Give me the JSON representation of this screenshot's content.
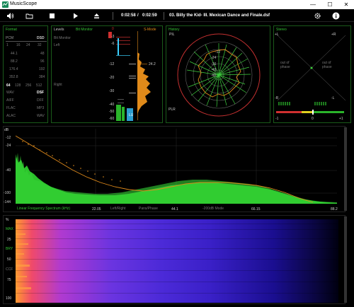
{
  "app": {
    "title": "MusicScope"
  },
  "toolbar": {
    "position": "0:02:58",
    "separator": "/",
    "duration": "0:02:59",
    "track": "03. Billy the Kid- III. Mexican Dance and Finale.dsf"
  },
  "format": {
    "title": "Format",
    "pcm": "PCM",
    "dsd": "DSD",
    "pcm_rates": [
      "1",
      "16",
      "24",
      "32"
    ],
    "rows": [
      [
        "44.1",
        "48"
      ],
      [
        "88.2",
        "96"
      ],
      [
        "176.4",
        "192"
      ],
      [
        "352.8",
        "384"
      ]
    ],
    "dsd_rates": [
      "64",
      "128",
      "256",
      "512"
    ],
    "pairs": [
      [
        "WAV",
        "DSF"
      ],
      [
        "AIFF",
        "DFF"
      ],
      [
        "FLAC",
        "MP3"
      ],
      [
        "ALAC",
        "WAV"
      ]
    ]
  },
  "levels": {
    "title": "Levels",
    "mode": "Bit Monitor",
    "left": "Left",
    "right": "Right",
    "bitmonitor": "Bit Monitor"
  },
  "meter": {
    "smode": "S-Mode",
    "ticks": [
      "0",
      "-3",
      "-6",
      "-12",
      "-20",
      "-30",
      "-40",
      "-50",
      "-60"
    ],
    "peak": "24.2",
    "lu": "LU"
  },
  "history": {
    "title": "History",
    "pil": "PIL",
    "plr": "PLR",
    "rings": [
      "-12",
      "-24",
      "-36",
      "-48",
      "-60"
    ]
  },
  "stereo": {
    "title": "Stereo",
    "plus_l": "+L",
    "plus_r": "+R",
    "minus_r": "-R",
    "minus_l": "-L",
    "out_of_phase": "out of phase",
    "scale_left": "-1",
    "scale_mid": "0",
    "scale_right": "+1"
  },
  "spectrum": {
    "db_unit": "dB",
    "db_ticks": [
      "-12",
      "-24",
      "-40",
      "-100",
      "-144"
    ],
    "mode_label": "Linear Frequency Spectrum (kHz)",
    "freq_ticks": [
      "22.05",
      "44.1",
      "66.15",
      "88.2"
    ],
    "lr_label": "Left/Right",
    "pp_label": "Pans/Phase",
    "mode2_label": "-200dB Mode"
  },
  "spectrogram": {
    "pct": "%",
    "labels": [
      "MAX",
      "25",
      "BRY",
      "50",
      "CCF",
      "75",
      "100"
    ]
  },
  "colors": {
    "accent_green": "#35c435",
    "orange": "#e08a1a",
    "cyan": "#3ad0ff",
    "red": "#d03030"
  }
}
